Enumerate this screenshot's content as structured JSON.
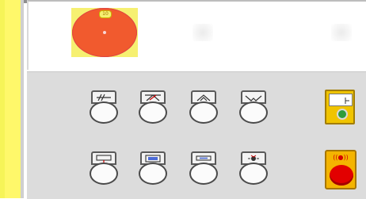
{
  "colors": {
    "left_strip": "#fff86a",
    "estop": "#f15a2e",
    "panel_bg": "#dcdcdc",
    "indicator_green": "#2f9c3a",
    "stop_red": "#e20000"
  },
  "estop": {
    "tab_label": "10"
  },
  "buttons_row1": [
    {
      "icon": "clamp-open-icon"
    },
    {
      "icon": "clamp-close-icon"
    },
    {
      "icon": "arrows-up-icon"
    },
    {
      "icon": "arrows-down-icon"
    }
  ],
  "buttons_row2": [
    {
      "icon": "screen-down-icon"
    },
    {
      "icon": "panel-icon"
    },
    {
      "icon": "bar-icon"
    },
    {
      "icon": "sensor-icon"
    }
  ],
  "indicator": {
    "icon": "green-lamp-icon"
  },
  "stop_button": {
    "icon": "red-stop-button-icon",
    "label": "((●))"
  }
}
